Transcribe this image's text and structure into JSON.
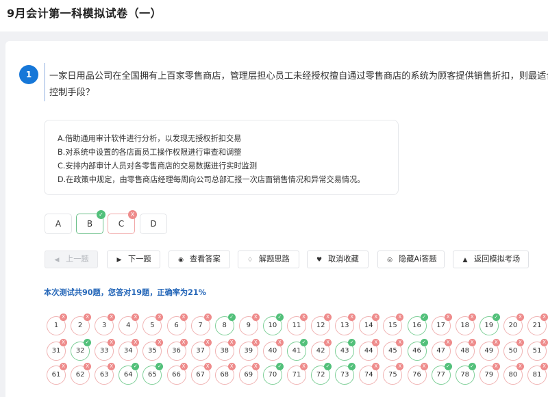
{
  "page_title": "9月会计第一科模拟试卷（一）",
  "question": {
    "number": "1",
    "text": "一家日用品公司在全国拥有上百家零售商店，管理层担心员工未经授权擅自通过零售商店的系统为顾客提供销售折扣，则最适合的控制手段？",
    "options": [
      "A.借助通用审计软件进行分析，以发现无授权折扣交易",
      "B.对系统中设置的各店面员工操作权限进行审查和调整",
      "C.安排内部审计人员对各零售商店的交易数据进行实时监测",
      "D.在政策中规定，由零售商店经理每周向公司总部汇报一次店面销售情况和异常交易情况。"
    ]
  },
  "answers": [
    {
      "label": "A",
      "state": "none"
    },
    {
      "label": "B",
      "state": "correct"
    },
    {
      "label": "C",
      "state": "wrong"
    },
    {
      "label": "D",
      "state": "none"
    }
  ],
  "marks": {
    "correct": "✓",
    "wrong": "X"
  },
  "toolbar": [
    {
      "label": "上一题",
      "icon": "caret-left-icon",
      "glyph": "◀",
      "disabled": true
    },
    {
      "label": "下一题",
      "icon": "caret-right-icon",
      "glyph": "▶",
      "disabled": false
    },
    {
      "label": "查看答案",
      "icon": "eye-icon",
      "glyph": "◉",
      "disabled": false
    },
    {
      "label": "解题思路",
      "icon": "bulb-icon",
      "glyph": "♢",
      "disabled": false
    },
    {
      "label": "取消收藏",
      "icon": "heart-icon",
      "glyph": "♥",
      "disabled": false
    },
    {
      "label": "隐藏Ai答题",
      "icon": "chat-icon",
      "glyph": "◎",
      "disabled": false
    },
    {
      "label": "返回模拟考场",
      "icon": "caret-up-icon",
      "glyph": "▲",
      "disabled": false
    }
  ],
  "summary": "本次测试共90题，您答对19题，正确率为21%",
  "question_grid": {
    "correct_numbers": [
      8,
      10,
      16,
      19,
      32,
      41,
      43,
      46,
      64,
      65,
      70,
      72,
      73,
      77,
      78
    ],
    "rows": [
      [
        1,
        2,
        3,
        4,
        5,
        6,
        7,
        8,
        9,
        10,
        11,
        12,
        13,
        14,
        15,
        16,
        17,
        18,
        19,
        20,
        21
      ],
      [
        31,
        32,
        33,
        34,
        35,
        36,
        37,
        38,
        39,
        40,
        41,
        42,
        43,
        44,
        45,
        46,
        47,
        48,
        49,
        50,
        51
      ],
      [
        61,
        62,
        63,
        64,
        65,
        66,
        67,
        68,
        69,
        70,
        71,
        72,
        73,
        74,
        75,
        76,
        77,
        78,
        79,
        80,
        81
      ]
    ]
  },
  "colors": {
    "accent": "#1677d8",
    "correct": "#52c07a",
    "wrong": "#ee8b8b",
    "summary": "#2466b8"
  }
}
